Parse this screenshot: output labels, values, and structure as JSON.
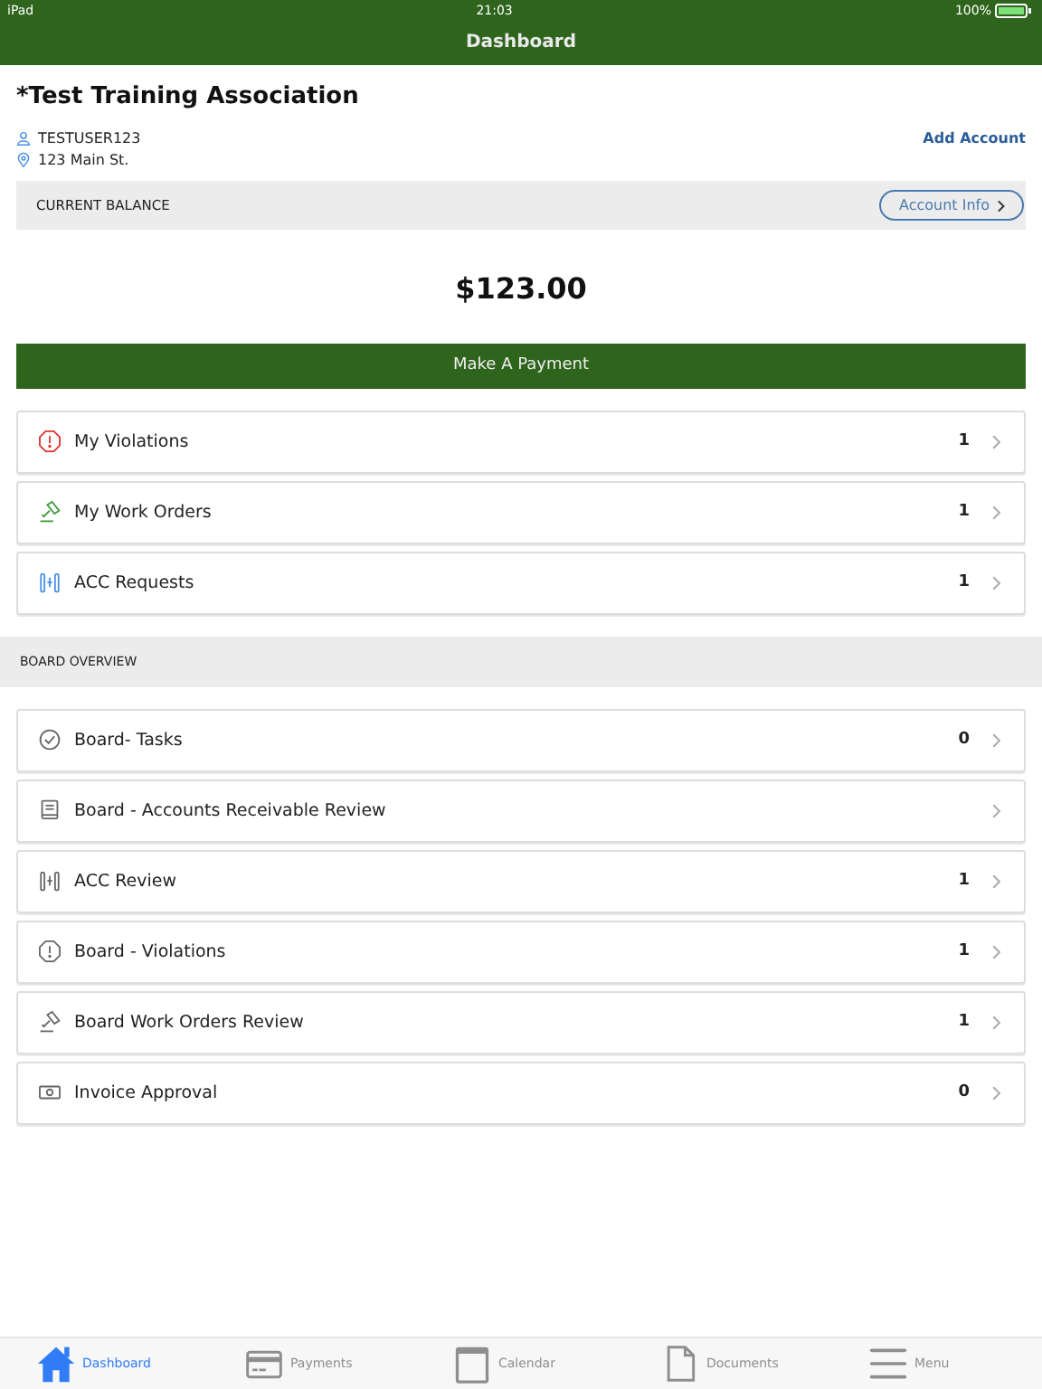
{
  "status_bar": {
    "device": "iPad",
    "time": "21:03",
    "battery": "100%"
  },
  "nav": {
    "title": "Dashboard"
  },
  "association": {
    "name": "*Test Training Association",
    "user": "TESTUSER123",
    "address": "123 Main St.",
    "add_account": "Add Account"
  },
  "balance": {
    "label": "CURRENT BALANCE",
    "account_info": "Account Info",
    "amount": "$123.00",
    "pay_button": "Make A Payment"
  },
  "my_items": [
    {
      "kind": "violation",
      "label": "My Violations",
      "count": "1",
      "color": "#e0312b"
    },
    {
      "kind": "workorder",
      "label": "My Work Orders",
      "count": "1",
      "color": "#3f9a3a"
    },
    {
      "kind": "acc",
      "label": "ACC Requests",
      "count": "1",
      "color": "#4a8fe7"
    }
  ],
  "board_overview": {
    "title": "BOARD OVERVIEW",
    "items": [
      {
        "kind": "tasks",
        "label": "Board- Tasks",
        "count": "0",
        "color": "#666666"
      },
      {
        "kind": "book",
        "label": "Board - Accounts Receivable Review",
        "color": "#666666"
      },
      {
        "kind": "acc",
        "label": "ACC Review",
        "count": "1",
        "color": "#666666"
      },
      {
        "kind": "violation",
        "label": "Board - Violations",
        "count": "1",
        "color": "#666666"
      },
      {
        "kind": "workorder",
        "label": "Board Work Orders Review",
        "count": "1",
        "color": "#666666"
      },
      {
        "kind": "money",
        "label": "Invoice Approval",
        "count": "0",
        "color": "#666666"
      }
    ]
  },
  "tab_bar": [
    {
      "kind": "home",
      "label": "Dashboard",
      "selected": true
    },
    {
      "kind": "card",
      "label": "Payments",
      "selected": false
    },
    {
      "kind": "calendar",
      "label": "Calendar",
      "selected": false
    },
    {
      "kind": "document",
      "label": "Documents",
      "selected": false
    },
    {
      "kind": "menu",
      "label": "Menu",
      "selected": false
    }
  ]
}
